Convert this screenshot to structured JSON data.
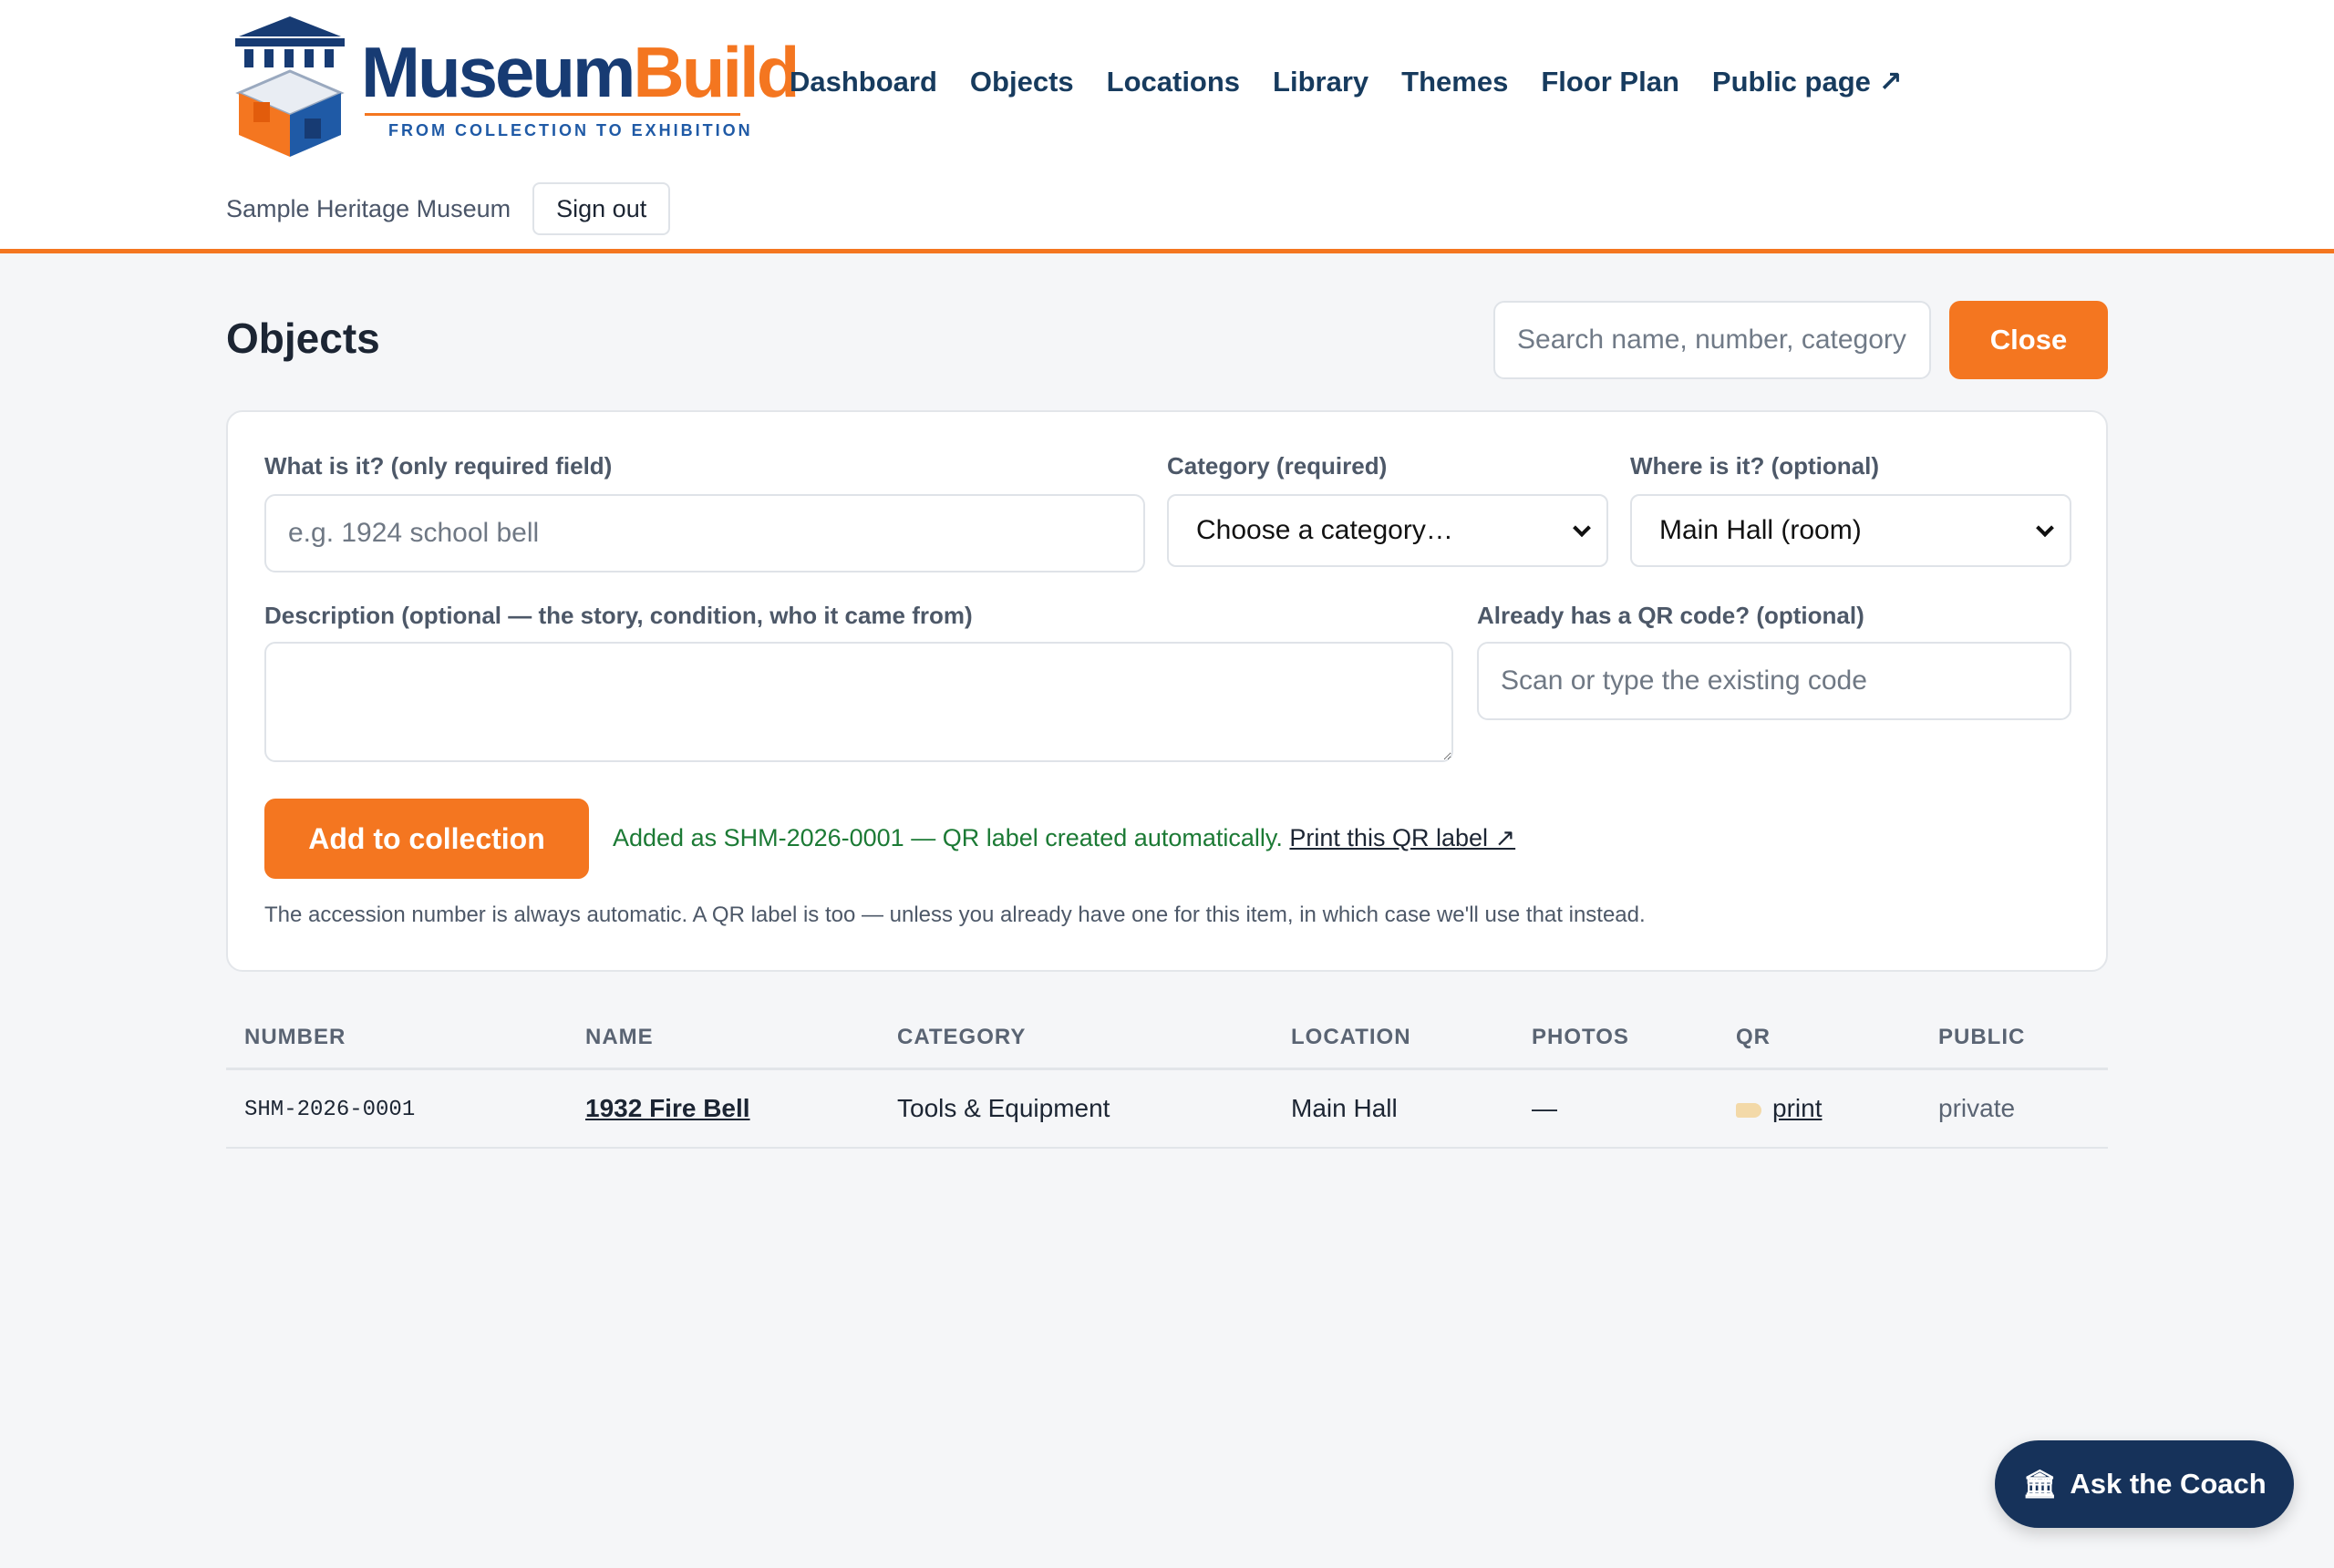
{
  "brand": {
    "word_part1": "Museum",
    "word_part2": "Build",
    "tagline": "FROM COLLECTION TO EXHIBITION",
    "colors": {
      "navy": "#173b73",
      "orange": "#f47620",
      "blue": "#1f5aa6"
    }
  },
  "nav": {
    "items": [
      "Dashboard",
      "Objects",
      "Locations",
      "Library",
      "Themes",
      "Floor Plan",
      "Public page ↗"
    ]
  },
  "account": {
    "org_name": "Sample Heritage Museum",
    "signout_label": "Sign out"
  },
  "page": {
    "title": "Objects",
    "search_placeholder": "Search name, number, category",
    "close_label": "Close"
  },
  "form": {
    "name_label": "What is it? (only required field)",
    "name_placeholder": "e.g. 1924 school bell",
    "category_label": "Category (required)",
    "category_value": "Choose a category…",
    "location_label": "Where is it? (optional)",
    "location_value": "Main Hall (room)",
    "description_label": "Description (optional — the story, condition, who it came from)",
    "qr_label": "Already has a QR code? (optional)",
    "qr_placeholder": "Scan or type the existing code",
    "add_label": "Add to collection",
    "success_text": "Added as SHM-2026-0001 — QR label created automatically.",
    "success_link": "Print this QR label ↗",
    "hint": "The accession number is always automatic. A QR label is too — unless you already have one for this item, in which case we'll use that instead."
  },
  "table": {
    "headers": [
      "NUMBER",
      "NAME",
      "CATEGORY",
      "LOCATION",
      "PHOTOS",
      "QR",
      "PUBLIC"
    ],
    "rows": [
      {
        "number": "SHM-2026-0001",
        "name": "1932 Fire Bell",
        "category": "Tools & Equipment",
        "location": "Main Hall",
        "photos": "—",
        "qr": "print",
        "qr_icon": "label-tag-icon",
        "public": "private"
      }
    ]
  },
  "coach": {
    "label": "Ask the Coach",
    "icon": "🏛"
  },
  "colors": {
    "accent": "#f47620",
    "success": "#1c7a35",
    "coach_bg": "#16325a"
  }
}
